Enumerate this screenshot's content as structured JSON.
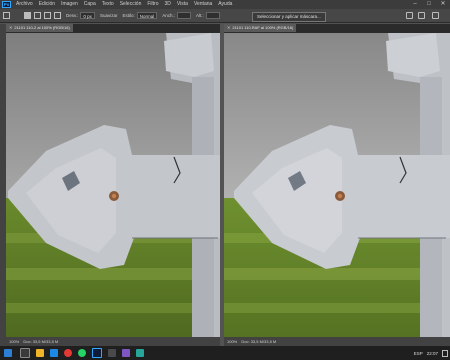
{
  "app": {
    "logo_text": "Ps"
  },
  "menu": [
    "Archivo",
    "Edición",
    "Imagen",
    "Capa",
    "Texto",
    "Selección",
    "Filtro",
    "3D",
    "Vista",
    "Ventana",
    "Ayuda"
  ],
  "window_controls": [
    "–",
    "□",
    "✕"
  ],
  "options": {
    "feather_label": "Desv.:",
    "feather_value": "0 px",
    "antialias_label": "Suavizar",
    "style_label": "Estilo:",
    "style_value": "Normal",
    "width_label": "Anch.:",
    "height_label": "Alt.:",
    "select_mask_button": "Seleccionar y aplicar máscara..."
  },
  "documents": [
    {
      "tab_title": "21101 110-2 al 100% (RGB/16)",
      "status_zoom": "100%",
      "status_doc": "Doc: 33,5 M/33,5 M"
    },
    {
      "tab_title": "21101 110.RAF al 100% (RGB/16)",
      "status_zoom": "100%",
      "status_doc": "Doc: 33,5 M/33,5 M"
    }
  ],
  "taskbar": {
    "language": "ESP",
    "time": "22:07"
  },
  "colors": {
    "menubar_bg": "#3c3c3c",
    "panel_bg": "#535353",
    "sky": "#9a9a9a",
    "grass": "#5f7a2a",
    "hinge": "#b8bcc2"
  }
}
